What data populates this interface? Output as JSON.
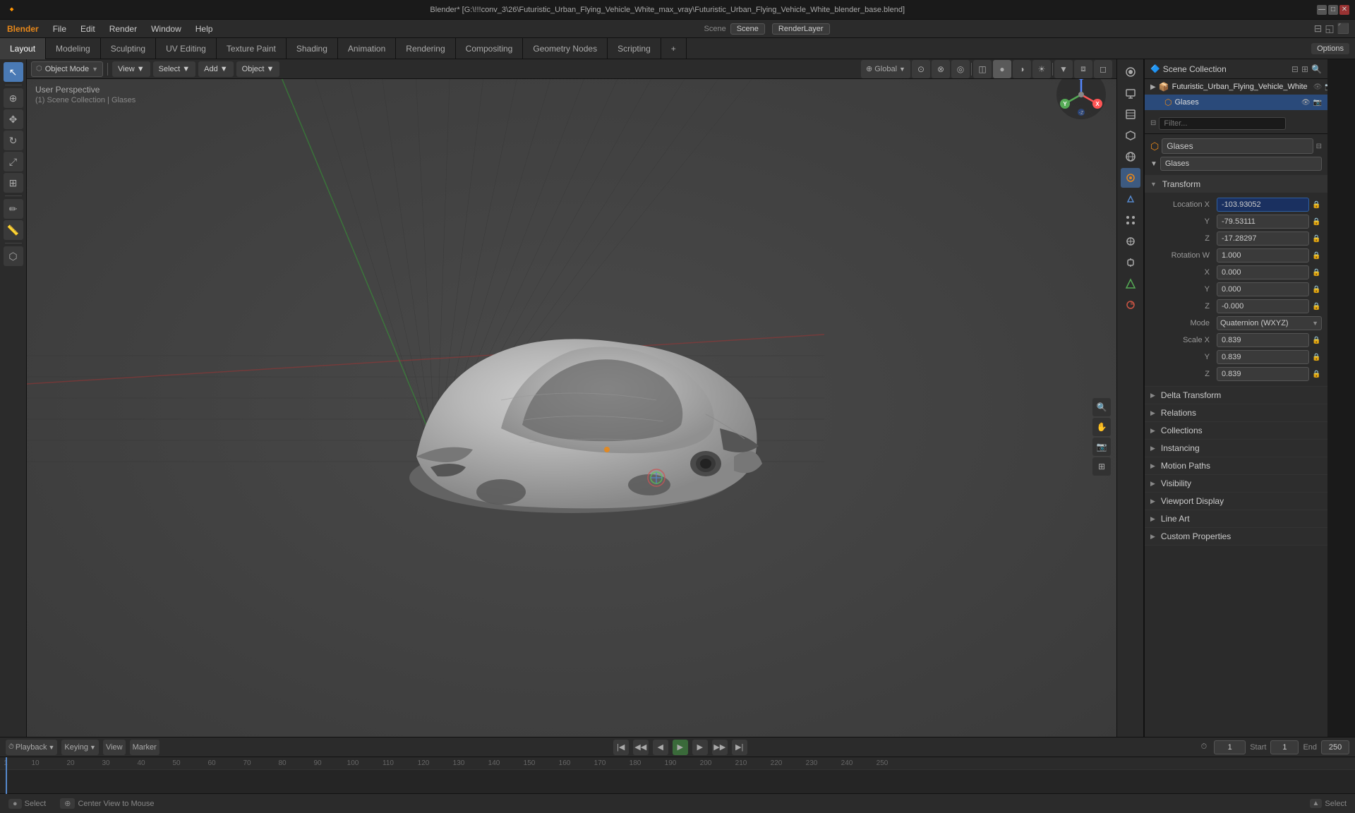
{
  "titlebar": {
    "title": "Blender* [G:\\!!!conv_3\\26\\Futuristic_Urban_Flying_Vehicle_White_max_vray\\Futuristic_Urban_Flying_Vehicle_White_blender_base.blend]",
    "controls": [
      "—",
      "□",
      "✕"
    ]
  },
  "menubar": {
    "items": [
      "Blender",
      "File",
      "Edit",
      "Render",
      "Window",
      "Help"
    ]
  },
  "workspaces": [
    {
      "label": "Layout",
      "active": true
    },
    {
      "label": "Modeling",
      "active": false
    },
    {
      "label": "Sculpting",
      "active": false
    },
    {
      "label": "UV Editing",
      "active": false
    },
    {
      "label": "Texture Paint",
      "active": false
    },
    {
      "label": "Shading",
      "active": false
    },
    {
      "label": "Animation",
      "active": false
    },
    {
      "label": "Rendering",
      "active": false
    },
    {
      "label": "Compositing",
      "active": false
    },
    {
      "label": "Geometry Nodes",
      "active": false
    },
    {
      "label": "Scripting",
      "active": false
    },
    {
      "label": "+",
      "active": false
    }
  ],
  "viewport": {
    "mode": "Object Mode",
    "view": "User Perspective",
    "collection": "(1) Scene Collection | Glases",
    "nav_menus": [
      "Object Mode",
      "View",
      "Select",
      "Add",
      "Object"
    ]
  },
  "outliner": {
    "title": "Scene Collection",
    "search_placeholder": "Filter...",
    "items": [
      {
        "name": "Futuristic_Urban_Flying_Vehicle_White",
        "icon": "📦",
        "selected": false
      }
    ]
  },
  "properties": {
    "object_name": "Glases",
    "tabs": [
      "scene",
      "render",
      "output",
      "view_layer",
      "scene2",
      "world",
      "object",
      "modifier",
      "particles",
      "physics",
      "constraints",
      "object_data",
      "material",
      "shader_nodes"
    ],
    "transform": {
      "title": "Transform",
      "location": {
        "x": "-103.93052",
        "y": "-79.53111",
        "z": "-17.28297"
      },
      "rotation": {
        "mode": "Quaternion (WXYZ)",
        "w": "1.000",
        "x": "0.000",
        "y": "0.000",
        "z": "-0.000"
      },
      "scale": {
        "x": "0.839",
        "y": "0.839",
        "z": "0.839"
      }
    },
    "sections": [
      {
        "label": "Delta Transform",
        "collapsed": true
      },
      {
        "label": "Relations",
        "collapsed": true
      },
      {
        "label": "Collections",
        "collapsed": true
      },
      {
        "label": "Instancing",
        "collapsed": true
      },
      {
        "label": "Motion Paths",
        "collapsed": true
      },
      {
        "label": "Visibility",
        "collapsed": true
      },
      {
        "label": "Viewport Display",
        "collapsed": true
      },
      {
        "label": "Line Art",
        "collapsed": true
      },
      {
        "label": "Custom Properties",
        "collapsed": true
      }
    ]
  },
  "timeline": {
    "playback_label": "Playback",
    "keying_label": "Keying",
    "view_label": "View",
    "marker_label": "Marker",
    "current_frame": "1",
    "start_frame": "1",
    "end_frame": "250",
    "frame_numbers": [
      "1",
      "10",
      "20",
      "30",
      "40",
      "50",
      "60",
      "70",
      "80",
      "90",
      "100",
      "110",
      "120",
      "130",
      "140",
      "150",
      "160",
      "170",
      "180",
      "190",
      "200",
      "210",
      "220",
      "230",
      "240",
      "250"
    ]
  },
  "statusbar": {
    "select_label": "Select",
    "center_view_label": "Center View to Mouse"
  },
  "icons": {
    "arrow": "▶",
    "chevron_right": "▶",
    "chevron_down": "▼",
    "lock": "🔒",
    "unlock": "🔓",
    "camera": "📷",
    "object": "⬡",
    "mesh": "◈",
    "eye": "👁",
    "cursor": "⊕",
    "move": "✥",
    "rotate": "↻",
    "scale": "⤢",
    "transform": "⊞",
    "annotate": "✏",
    "measure": "📏",
    "dot": "●"
  }
}
